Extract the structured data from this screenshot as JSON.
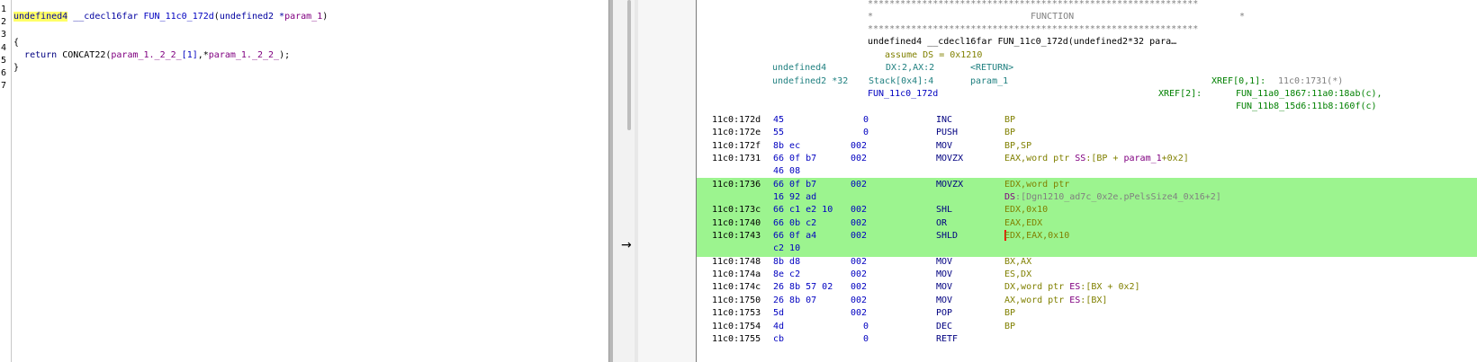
{
  "decompiler": {
    "line_numbers": [
      "1",
      "2",
      "3",
      "4",
      "5",
      "6",
      "7"
    ],
    "line2": {
      "ret_type": "undefined4",
      "callconv": " __cdecl16far ",
      "func_name": "FUN_11c0_172d",
      "open_paren": "(",
      "param_type": "undefined2 *",
      "param_name": "param_1",
      "close_paren": ")"
    },
    "line4": "{",
    "line5": {
      "indent": "  ",
      "keyword": "return",
      "call": " CONCAT22(",
      "arg1": "param_1._2_2_",
      "arg1_idx": "[1]",
      "comma_star": ",*",
      "arg2": "param_1._2_2_",
      "tail": ");"
    },
    "line6": "}"
  },
  "midbar": {
    "arrow": "→"
  },
  "listing": {
    "header": {
      "stars": "*************************************************************",
      "func_banner_left": "*",
      "func_banner_center": "FUNCTION",
      "func_banner_right": "*",
      "signature": "undefined4 __cdecl16far FUN_11c0_172d(undefined2*32 para…",
      "assume": "assume DS = 0x1210",
      "ret_type": "undefined4",
      "ret_loc": "DX:2,AX:2",
      "ret_name": "<RETURN>",
      "param_type": "undefined2 *32",
      "param_loc": "Stack[0x4]:4",
      "param_name": "param_1",
      "xref1_label": "XREF[0,1]:",
      "xref1_value": "11c0:1731(*)",
      "label": "FUN_11c0_172d",
      "xref2_label": "XREF[2]:",
      "xref2_value1": "FUN_11a0_1867:11a0:18ab(c),",
      "xref2_value2": "FUN_11b8_15d6:11b8:160f(c)"
    },
    "rows": [
      {
        "addr": "11c0:172d",
        "bytes": "45",
        "sp": "0",
        "mnem": "INC",
        "ops": "BP"
      },
      {
        "addr": "11c0:172e",
        "bytes": "55",
        "sp": "0",
        "mnem": "PUSH",
        "ops": "BP"
      },
      {
        "addr": "11c0:172f",
        "bytes": "8b ec",
        "sp": "002",
        "mnem": "MOV",
        "ops": "BP,SP"
      },
      {
        "addr": "11c0:1731",
        "bytes": "66 0f b7",
        "sp": "002",
        "mnem": "MOVZX",
        "ops_a": "EAX,word ptr ",
        "ops_seg": "SS",
        "ops_b": ":[BP + ",
        "ops_param": "param_1",
        "ops_c": "+0x2]",
        "bytes2": "46 08"
      },
      {
        "addr": "11c0:1736",
        "bytes": "66 0f b7",
        "sp": "002",
        "mnem": "MOVZX",
        "ops": "EDX,word ptr",
        "bytes2": "16 92 ad",
        "ops2_seg": "DS",
        "ops2_b": ":[Dgn1210_ad7c_0x2e.pPelsSize4_0x16+2]"
      },
      {
        "addr": "11c0:173c",
        "bytes": "66 c1 e2 10",
        "sp": "002",
        "mnem": "SHL",
        "ops": "EDX,0x10"
      },
      {
        "addr": "11c0:1740",
        "bytes": "66 0b c2",
        "sp": "002",
        "mnem": "OR",
        "ops": "EAX,EDX"
      },
      {
        "addr": "11c0:1743",
        "bytes": "66 0f a4",
        "sp": "002",
        "mnem": "SHLD",
        "ops": "EDX,EAX,0x10",
        "bytes2": "c2 10"
      },
      {
        "addr": "11c0:1748",
        "bytes": "8b d8",
        "sp": "002",
        "mnem": "MOV",
        "ops": "BX,AX"
      },
      {
        "addr": "11c0:174a",
        "bytes": "8e c2",
        "sp": "002",
        "mnem": "MOV",
        "ops": "ES,DX"
      },
      {
        "addr": "11c0:174c",
        "bytes": "26 8b 57 02",
        "sp": "002",
        "mnem": "MOV",
        "ops_a": "DX,word ptr ",
        "ops_seg": "ES",
        "ops_c": ":[BX + 0x2]"
      },
      {
        "addr": "11c0:1750",
        "bytes": "26 8b 07",
        "sp": "002",
        "mnem": "MOV",
        "ops_a": "AX,word ptr ",
        "ops_seg": "ES",
        "ops_c": ":[BX]"
      },
      {
        "addr": "11c0:1753",
        "bytes": "5d",
        "sp": "002",
        "mnem": "POP",
        "ops": "BP"
      },
      {
        "addr": "11c0:1754",
        "bytes": "4d",
        "sp": "0",
        "mnem": "DEC",
        "ops": "BP"
      },
      {
        "addr": "11c0:1755",
        "bytes": "cb",
        "sp": "0",
        "mnem": "RETF",
        "ops": ""
      }
    ]
  },
  "colors": {
    "highlight_green": "#9cf48f",
    "highlight_yellow": "#ffff66",
    "cursor_red": "#ff0000"
  }
}
